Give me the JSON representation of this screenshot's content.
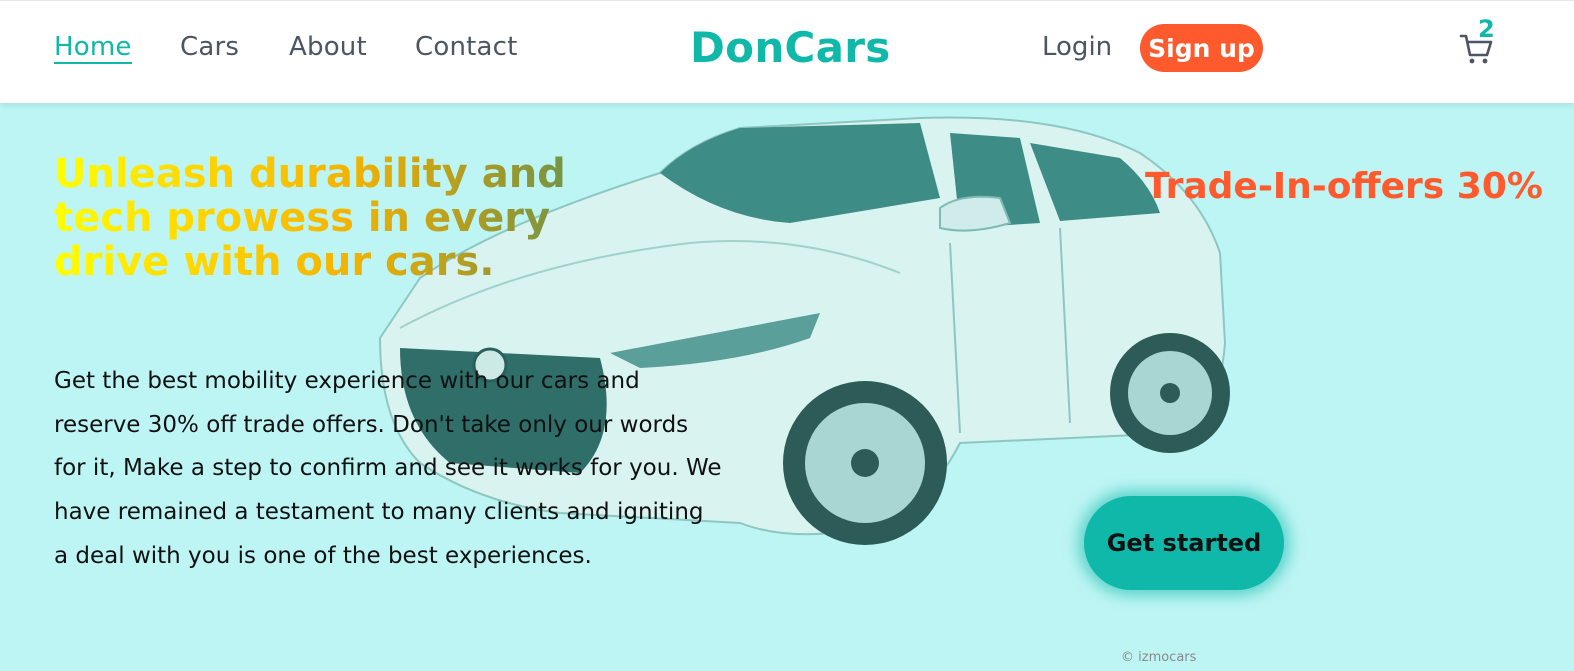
{
  "nav": {
    "links": [
      {
        "label": "Home"
      },
      {
        "label": "Cars"
      },
      {
        "label": "About"
      },
      {
        "label": "Contact"
      }
    ],
    "active": "Home"
  },
  "brand": {
    "name": "DonCars"
  },
  "auth": {
    "login_label": "Login",
    "signup_label": "Sign up"
  },
  "cart": {
    "icon": "cart-icon",
    "count": "2"
  },
  "hero": {
    "headline": "Unleash durability and tech prowess in every drive with our cars.",
    "offer": "Trade-In-offers 30%",
    "paragraph": "Get the best mobility experience with our cars and reserve 30% off trade offers. Don't take only our words for it, Make a step to confirm and see it works for you. We have remained a testament to many clients and igniting a deal with you is one of the best experiences.",
    "cta_label": "Get started",
    "image": "car-image",
    "watermark": "© izmocars"
  },
  "colors": {
    "accent": "#0fb8a8",
    "orange": "#ff5a2e",
    "hero_bg": "#bdf5f4",
    "nav_text": "#4b5563"
  }
}
